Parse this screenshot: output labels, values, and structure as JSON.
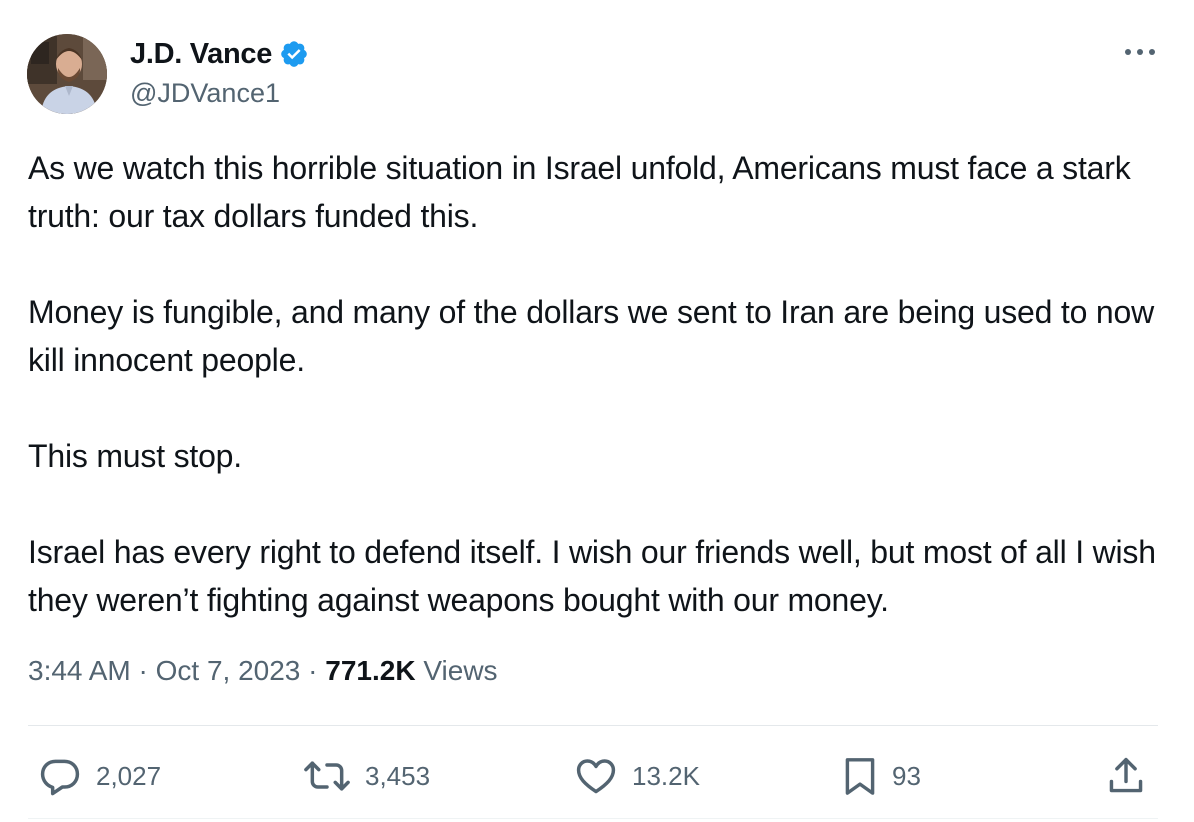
{
  "author": {
    "display_name": "J.D. Vance",
    "handle": "@JDVance1",
    "verified": true,
    "verified_color": "#1d9bf0",
    "avatar": "profile-photo"
  },
  "menu": {
    "icon": "more-horizontal-icon"
  },
  "post": {
    "paragraphs": [
      "As we watch this horrible situation in Israel unfold, Americans must face a stark truth: our tax dollars funded this.",
      "Money is fungible, and many of the dollars we sent to Iran are being used to now kill innocent people.",
      "This must stop.",
      "Israel has every right to defend itself. I wish our friends well, but most of all I wish they weren’t fighting against weapons bought with our money."
    ],
    "time": "3:44 AM",
    "separator": "·",
    "date": "Oct 7, 2023",
    "views_count": "771.2K",
    "views_label": "Views"
  },
  "actions": {
    "replies": {
      "icon": "reply-icon",
      "count": "2,027"
    },
    "reposts": {
      "icon": "repost-icon",
      "count": "3,453"
    },
    "likes": {
      "icon": "heart-icon",
      "count": "13.2K"
    },
    "bookmarks": {
      "icon": "bookmark-icon",
      "count": "93"
    },
    "share": {
      "icon": "share-icon"
    }
  },
  "colors": {
    "text_primary": "#0f1419",
    "text_secondary": "#536471",
    "divider": "#e4e8eb"
  }
}
